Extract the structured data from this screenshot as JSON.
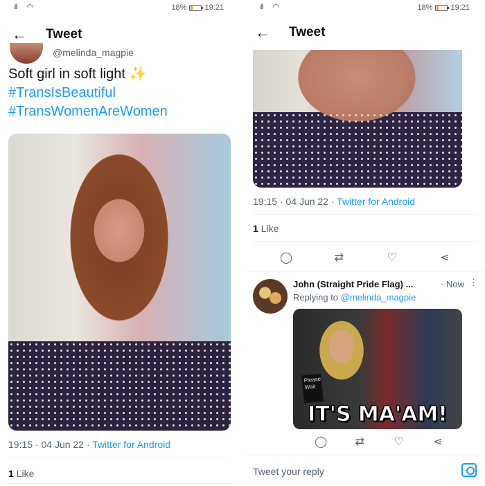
{
  "left": {
    "status": {
      "battery": "18%",
      "time": "19:21",
      "battery_level": 0.18
    },
    "header": {
      "title": "Tweet"
    },
    "tweet": {
      "handle": "@melinda_magpie",
      "text": "Soft girl in soft light ✨",
      "hashtags": [
        "#TransIsBeautiful",
        "#TransWomenAreWomen"
      ],
      "meta_time": "19:15 · 04 Jun 22 · ",
      "meta_source": "Twitter for Android",
      "likes_count": "1",
      "likes_label": " Like"
    }
  },
  "right": {
    "status": {
      "battery": "18%",
      "time": "19:21",
      "battery_level": 0.18
    },
    "header": {
      "title": "Tweet"
    },
    "tweet": {
      "meta_time": "19:15 · 04 Jun 22 · ",
      "meta_source": "Twitter for Android",
      "likes_count": "1",
      "likes_label": " Like"
    },
    "reply": {
      "name": "John (Straight Pride Flag) ...",
      "time": "· Now",
      "replying_prefix": "Replying to ",
      "replying_to": "@melinda_magpie",
      "gif_sign": "Please Wait",
      "gif_caption": "IT'S MA'AM!"
    },
    "compose": {
      "placeholder": "Tweet your reply"
    }
  },
  "icons": {
    "back": "←",
    "reply": "◯",
    "retweet": "⇄",
    "like": "♡",
    "share": "⋖",
    "more": "⋮",
    "wifi": "◠",
    "signal": "ıll"
  },
  "colors": {
    "accent": "#1d9bf0",
    "muted": "#536471",
    "text": "#0f1419"
  }
}
